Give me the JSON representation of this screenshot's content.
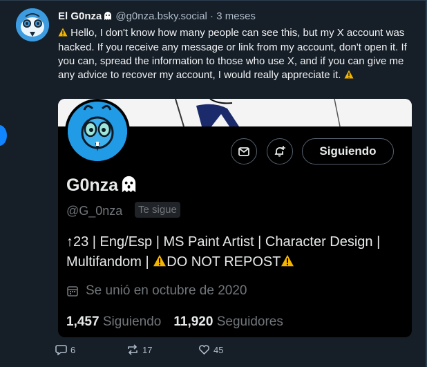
{
  "post": {
    "author_name": "El G0nza",
    "author_handle": "@g0nza.bsky.social",
    "separator": "·",
    "time": "3 meses",
    "text": "Hello, I don't know how many people can see this, but my X account was hacked. If you receive any message or link from my account, don't open it. If you can, spread the information to those who use X, and if you can give me any advice to recover my account, I would really appreciate it.",
    "counts": {
      "replies": "6",
      "reposts": "17",
      "likes": "45"
    }
  },
  "profile_card": {
    "name": "G0nza",
    "handle": "@G_0nza",
    "follows_you": "Te sigue",
    "follow_button": "Siguiendo",
    "bio_prefix": "↑23 | Eng/Esp | MS Paint Artist | Character Design | Multifandom | ",
    "bio_warning": "DO NOT REPOST",
    "joined": "Se unió en octubre de 2020",
    "following_count": "1,457",
    "following_label": "Siguiendo",
    "followers_count": "11,920",
    "followers_label": "Seguidores"
  },
  "icons": {
    "reply": "speech-bubble-icon",
    "repost": "repost-arrows-icon",
    "like": "heart-icon",
    "more": "ellipsis-icon",
    "message": "envelope-icon",
    "notify": "bell-plus-icon",
    "calendar": "calendar-icon",
    "warning": "warning-sign-icon",
    "ghost": "ghost-emoji-icon"
  },
  "colors": {
    "background": "#161e27",
    "card": "#000000",
    "accent": "#1185fe",
    "muted": "#aebbc9",
    "warning": "#f5b400"
  }
}
